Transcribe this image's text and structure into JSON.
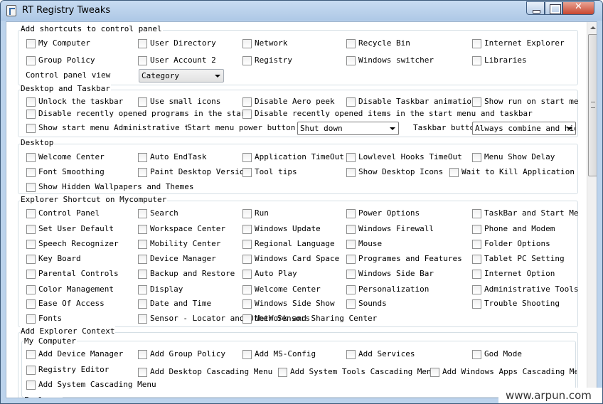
{
  "window": {
    "title": "RT Registry Tweaks",
    "close_glyph": "✕"
  },
  "watermark": "www.arpun.com",
  "sections": {
    "shortcuts": {
      "title": "Add shortcuts to control panel",
      "items": [
        "My Computer",
        "User Directory",
        "Network",
        "Recycle Bin",
        "Internet Explorer",
        "Group Policy",
        "User Account 2",
        "Registry",
        "Windows switcher",
        "Libraries"
      ],
      "view_label": "Control panel view",
      "view_value": "Category"
    },
    "taskbar": {
      "title": "Desktop and Taskbar",
      "items": [
        "Unlock the taskbar",
        "Use small icons",
        "Disable Aero peek",
        "Disable Taskbar animations",
        "Show run on start menu",
        "Disable recently opened programs in the start menu",
        "Disable recently opened items in the start menu and taskbar",
        "Show start menu Administrative tools"
      ],
      "power_label": "Start menu power button action",
      "power_value": "Shut down",
      "taskbar_label": "Taskbar buttons",
      "taskbar_value": "Always combine and hide labels"
    },
    "desktop": {
      "title": "Desktop",
      "items": [
        "Welcome Center",
        "Auto EndTask",
        "Application TimeOut",
        "Lowlevel Hooks TimeOut",
        "Menu Show Delay",
        "Font Smoothing",
        "Paint Desktop Version",
        "Tool tips",
        "Show Desktop Icons",
        "Wait to Kill Application Time",
        "Show Hidden Wallpapers and Themes"
      ]
    },
    "explorer": {
      "title": "Explorer Shortcut on Mycomputer",
      "items": [
        "Control Panel",
        "Search",
        "Run",
        "Power Options",
        "TaskBar and Start Menu",
        "Set User Default",
        "Workspace Center",
        "Windows Update",
        "Windows Firewall",
        "Phone and Modem",
        "Speech Recognizer",
        "Mobility Center",
        "Regional Language",
        "Mouse",
        "Folder Options",
        "Key Board",
        "Device Manager",
        "Windows Card Space",
        "Programes and Features",
        "Tablet PC Setting",
        "Parental Controls",
        "Backup and Restore",
        "Auto Play",
        "Windows Side Bar",
        "Internet Option",
        "Color Management",
        "Display",
        "Welcome Center",
        "Personalization",
        "Administrative Tools",
        "Ease Of Access",
        "Date and Time",
        "Windows Side Show",
        "Sounds",
        "Trouble Shooting",
        "Fonts",
        "Sensor - Locator and Other Sensors",
        "NetWork and Sharing Center"
      ]
    },
    "context": {
      "title": "Add Explorer Context",
      "subtitle": "My Computer",
      "items": [
        "Add Device Manager",
        "Add Group Policy",
        "Add MS-Config",
        "Add Services",
        "God Mode",
        "Registry Editor",
        "Add Desktop Cascading Menu",
        "Add System Tools Cascading Menu",
        "Add Windows Apps Cascading Menu",
        "Add System Cascading Menu"
      ],
      "next_title": "Explorer"
    }
  }
}
